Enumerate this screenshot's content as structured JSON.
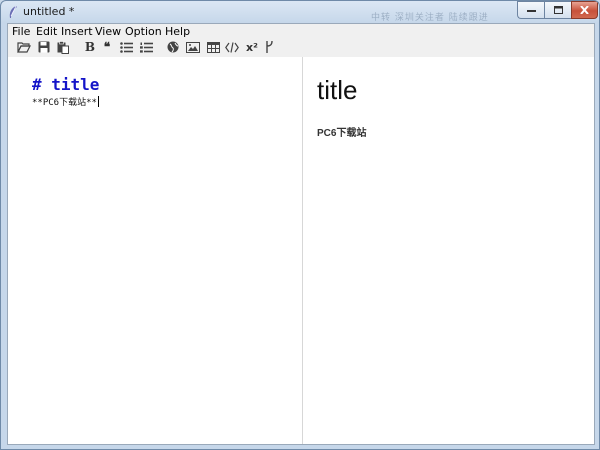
{
  "window": {
    "title": "untitled *",
    "blurred_title_text": "中转  深圳关注者  陆续跟进"
  },
  "menu": {
    "items": [
      {
        "label": "File"
      },
      {
        "label": "Edit"
      },
      {
        "label": "Insert"
      },
      {
        "label": "View"
      },
      {
        "label": "Option"
      },
      {
        "label": "Help"
      }
    ]
  },
  "toolbar": {
    "bold_label": "B",
    "quote_label": "❝",
    "superscript_label": "x²",
    "icons": [
      "open-folder-icon",
      "save-icon",
      "paste-icon",
      "bold-icon",
      "quote-icon",
      "bullet-list-icon",
      "numbered-list-icon",
      "globe-link-icon",
      "image-icon",
      "table-icon",
      "code-icon",
      "superscript-icon",
      "branch-icon"
    ]
  },
  "editor": {
    "line1": "# title",
    "line2": "**PC6下载站**"
  },
  "preview": {
    "heading": "title",
    "bold_text": "PC6下载站"
  }
}
